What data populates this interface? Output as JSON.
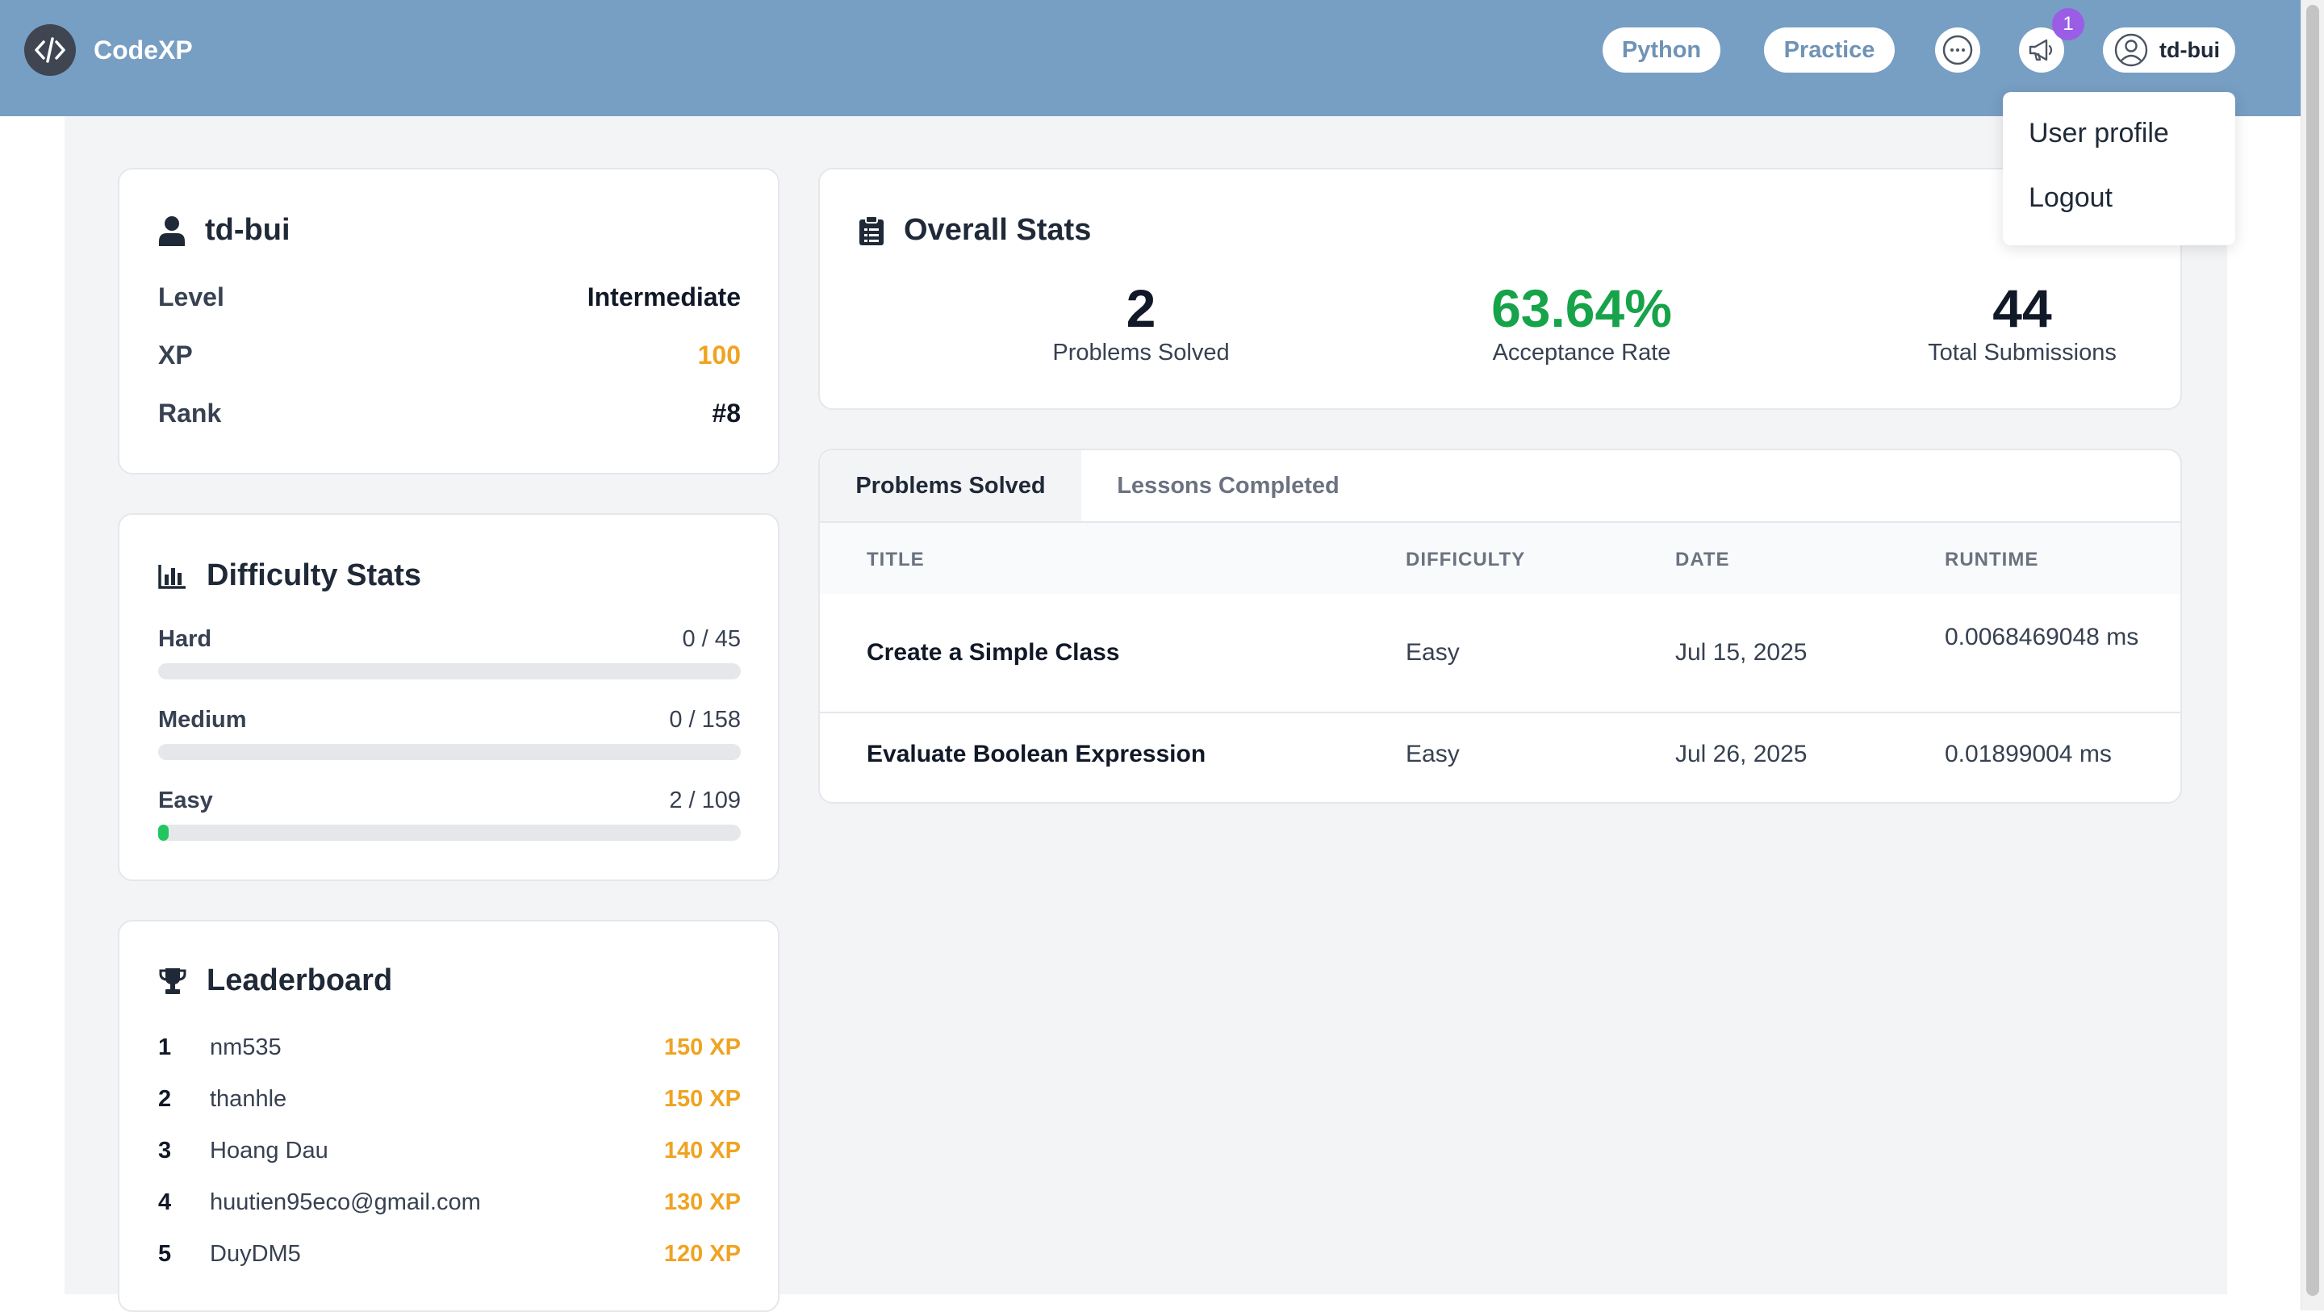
{
  "header": {
    "app_name": "CodeXP",
    "nav": {
      "python": "Python",
      "practice": "Practice"
    },
    "notification_count": "1",
    "username": "td-bui"
  },
  "dropdown": {
    "items": [
      "User profile",
      "Logout"
    ]
  },
  "profile": {
    "username": "td-bui",
    "rows": [
      {
        "label": "Level",
        "value": "Intermediate"
      },
      {
        "label": "XP",
        "value": "100"
      },
      {
        "label": "Rank",
        "value": "#8"
      }
    ]
  },
  "difficulty": {
    "title": "Difficulty Stats",
    "items": [
      {
        "label": "Hard",
        "value": "0 / 45",
        "progress": 0
      },
      {
        "label": "Medium",
        "value": "0 / 158",
        "progress": 0
      },
      {
        "label": "Easy",
        "value": "2 / 109",
        "progress": 0.018
      }
    ]
  },
  "leaderboard": {
    "title": "Leaderboard",
    "entries": [
      {
        "rank": "1",
        "name": "nm535",
        "xp": "150 XP"
      },
      {
        "rank": "2",
        "name": "thanhle",
        "xp": "150 XP"
      },
      {
        "rank": "3",
        "name": "Hoang Dau",
        "xp": "140 XP"
      },
      {
        "rank": "4",
        "name": "huutien95eco@gmail.com",
        "xp": "130 XP"
      },
      {
        "rank": "5",
        "name": "DuyDM5",
        "xp": "120 XP"
      }
    ]
  },
  "overall": {
    "title": "Overall Stats",
    "stats": [
      {
        "value": "2",
        "label": "Problems Solved"
      },
      {
        "value": "63.64%",
        "label": "Acceptance Rate"
      },
      {
        "value": "44",
        "label": "Total Submissions"
      }
    ]
  },
  "tabs": {
    "active": "Problems Solved",
    "inactive": "Lessons Completed"
  },
  "table": {
    "columns": [
      "TITLE",
      "DIFFICULTY",
      "DATE",
      "RUNTIME"
    ],
    "rows": [
      {
        "title": "Create a Simple Class",
        "difficulty": "Easy",
        "date": "Jul 15, 2025",
        "runtime": "0.0068469048 ms"
      },
      {
        "title": "Evaluate Boolean Expression",
        "difficulty": "Easy",
        "date": "Jul 26, 2025",
        "runtime": "0.01899004 ms"
      }
    ]
  },
  "colors": {
    "header": "#779ec3",
    "xp": "#f0a321",
    "acceptance": "#16a34a",
    "progress": "#22c55e",
    "badge": "#9b5de5"
  }
}
